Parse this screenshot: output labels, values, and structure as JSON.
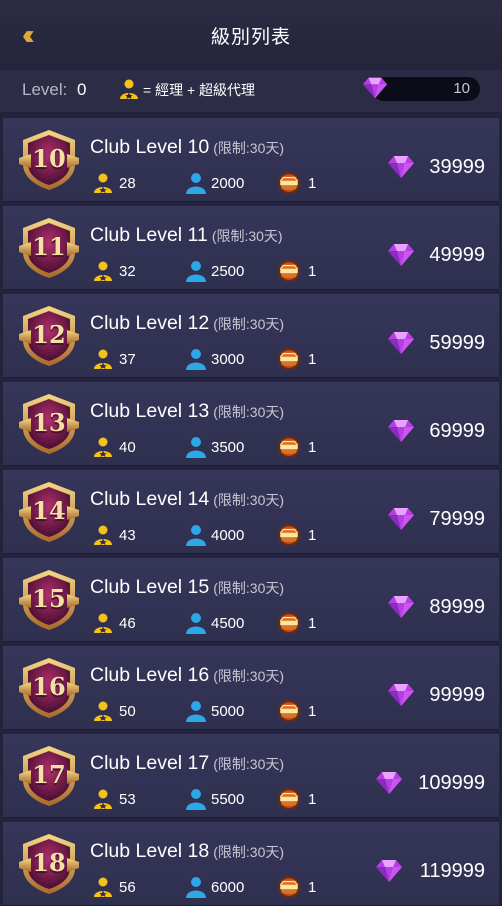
{
  "header": {
    "title": "級別列表",
    "back_icon": "double-chevron-left-icon"
  },
  "infobar": {
    "level_label": "Level:",
    "level_value": "0",
    "legend_text": "= 經理 + 超級代理",
    "gem_balance": "10"
  },
  "colors": {
    "accent": "#e0a83a",
    "manager_icon": "#f3c31a",
    "member_icon": "#2ea7e8",
    "gem": "#c64be8"
  },
  "levels": [
    {
      "badge": "10",
      "name": "Club Level 10",
      "limit": "(限制:30天)",
      "managers": "28",
      "members": "2000",
      "clubs": "1",
      "price": "39999"
    },
    {
      "badge": "11",
      "name": "Club Level 11",
      "limit": "(限制:30天)",
      "managers": "32",
      "members": "2500",
      "clubs": "1",
      "price": "49999"
    },
    {
      "badge": "12",
      "name": "Club Level 12",
      "limit": "(限制:30天)",
      "managers": "37",
      "members": "3000",
      "clubs": "1",
      "price": "59999"
    },
    {
      "badge": "13",
      "name": "Club Level 13",
      "limit": "(限制:30天)",
      "managers": "40",
      "members": "3500",
      "clubs": "1",
      "price": "69999"
    },
    {
      "badge": "14",
      "name": "Club Level 14",
      "limit": "(限制:30天)",
      "managers": "43",
      "members": "4000",
      "clubs": "1",
      "price": "79999"
    },
    {
      "badge": "15",
      "name": "Club Level 15",
      "limit": "(限制:30天)",
      "managers": "46",
      "members": "4500",
      "clubs": "1",
      "price": "89999"
    },
    {
      "badge": "16",
      "name": "Club Level 16",
      "limit": "(限制:30天)",
      "managers": "50",
      "members": "5000",
      "clubs": "1",
      "price": "99999"
    },
    {
      "badge": "17",
      "name": "Club Level 17",
      "limit": "(限制:30天)",
      "managers": "53",
      "members": "5500",
      "clubs": "1",
      "price": "109999"
    },
    {
      "badge": "18",
      "name": "Club Level 18",
      "limit": "(限制:30天)",
      "managers": "56",
      "members": "6000",
      "clubs": "1",
      "price": "119999"
    }
  ]
}
